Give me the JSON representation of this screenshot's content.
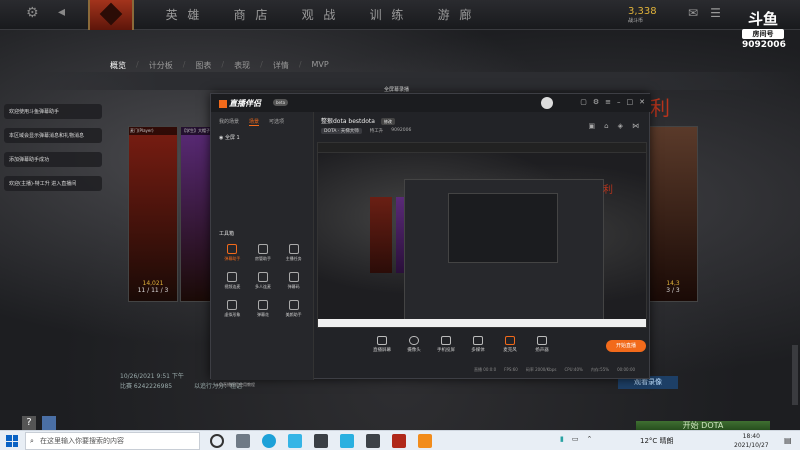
{
  "dota": {
    "nav": [
      "英 雄",
      "商 店",
      "观 战",
      "训 练",
      "游 廊"
    ],
    "gold": "3,338",
    "gold_caption": "战斗币",
    "sub_tabs": [
      "概览",
      "计分板",
      "图表",
      "表现",
      "详情",
      "MVP"
    ],
    "win_text": "利",
    "match_time": "10/26/2021 9:51 下午",
    "match_id": "比赛 6242226985",
    "extra_info": "以追行为分：粗话",
    "replay_button": "观看录像",
    "play_button": "开始 DOTA",
    "heroes": [
      {
        "tag": "麦门(Player)",
        "gpm": "14,021",
        "kda": "11 / 11 / 3",
        "color": "#7a1d12"
      },
      {
        "tag": "【学生】大帽子",
        "gpm": "",
        "kda": "",
        "color": "#5a2a78"
      },
      {
        "tag": "",
        "gpm": "14,3",
        "kda": "3 / 3",
        "color": "#5a3a2a"
      }
    ]
  },
  "douyu": {
    "logo": "斗鱼",
    "room_label": "房间号",
    "room_number": "9092006"
  },
  "notifications": [
    "欢迎使用斗鱼弹幕助手",
    "本区域会显示弹幕消息和礼物消息",
    "添加弹幕助手成功",
    "欢迎(主播)-特工升 进入直播间"
  ],
  "fullscreen_label": "全屏幕录播",
  "assistant": {
    "title": "直播伴侣",
    "version": "beta",
    "left_tabs": [
      "我的场景",
      "场景",
      "可选项"
    ],
    "scene": "全屏 1",
    "tools_title": "工具箱",
    "tools": [
      {
        "label": "弹幕助手",
        "active": true
      },
      {
        "label": "房管助手",
        "active": false
      },
      {
        "label": "主播任务",
        "active": false
      },
      {
        "label": "视频连麦",
        "active": false
      },
      {
        "label": "多人连麦",
        "active": false
      },
      {
        "label": "弹幕码",
        "active": false
      },
      {
        "label": "虚拟形象",
        "active": false
      },
      {
        "label": "弹幕花",
        "active": false
      },
      {
        "label": "美颜助手",
        "active": false
      }
    ],
    "dm_bar": "斗鱼直播伴侣使用教程",
    "stream_title": "整狠dota bestdota",
    "edit_label": "修改",
    "category": "DOTA · 天梯大师",
    "worker_label": "特工升",
    "room_id": "9092006",
    "actions": [
      "直播屏幕",
      "摄像头",
      "手机投屏",
      "多媒体",
      "麦克风",
      "扬声器"
    ],
    "live_button": "开始直播",
    "status": [
      "直播 00:0:0",
      "FPS:60",
      "码率 2000/Kbps",
      "CPU:40%",
      "内存:55%",
      "00:00:00"
    ]
  },
  "taskbar": {
    "search_placeholder": "在这里输入你要搜索的内容",
    "weather": "12°C 晴朗",
    "time": "18:40",
    "date": "2021/10/27"
  }
}
